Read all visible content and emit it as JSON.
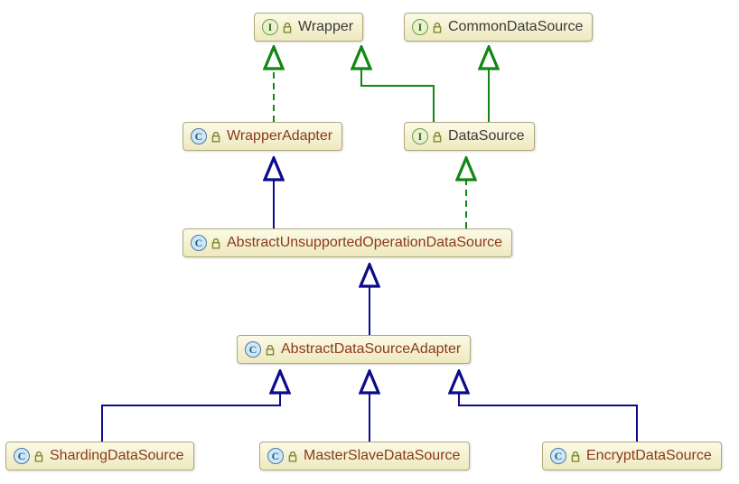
{
  "chart_data": {
    "type": "uml-class-diagram",
    "nodes": [
      {
        "id": "wrapper",
        "label": "Wrapper",
        "kind": "interface"
      },
      {
        "id": "common",
        "label": "CommonDataSource",
        "kind": "interface"
      },
      {
        "id": "wrapadpt",
        "label": "WrapperAdapter",
        "kind": "class"
      },
      {
        "id": "ds",
        "label": "DataSource",
        "kind": "interface"
      },
      {
        "id": "abunsup",
        "label": "AbstractUnsupportedOperationDataSource",
        "kind": "class"
      },
      {
        "id": "abadpt",
        "label": "AbstractDataSourceAdapter",
        "kind": "class"
      },
      {
        "id": "sharding",
        "label": "ShardingDataSource",
        "kind": "class"
      },
      {
        "id": "master",
        "label": "MasterSlaveDataSource",
        "kind": "class"
      },
      {
        "id": "encrypt",
        "label": "EncryptDataSource",
        "kind": "class"
      }
    ],
    "edges": [
      {
        "from": "wrapadpt",
        "to": "wrapper",
        "relation": "implements"
      },
      {
        "from": "ds",
        "to": "wrapper",
        "relation": "extends-interface"
      },
      {
        "from": "ds",
        "to": "common",
        "relation": "extends-interface"
      },
      {
        "from": "abunsup",
        "to": "wrapadpt",
        "relation": "extends"
      },
      {
        "from": "abunsup",
        "to": "ds",
        "relation": "implements"
      },
      {
        "from": "abadpt",
        "to": "abunsup",
        "relation": "extends"
      },
      {
        "from": "sharding",
        "to": "abadpt",
        "relation": "extends"
      },
      {
        "from": "master",
        "to": "abadpt",
        "relation": "extends"
      },
      {
        "from": "encrypt",
        "to": "abadpt",
        "relation": "extends"
      }
    ]
  },
  "colors": {
    "extends_arrow": "#0b0b8c",
    "implements_arrow": "#128612",
    "node_fill_top": "#fbfae6",
    "node_fill_bottom": "#eee9bf",
    "node_border": "#b0a87c"
  }
}
